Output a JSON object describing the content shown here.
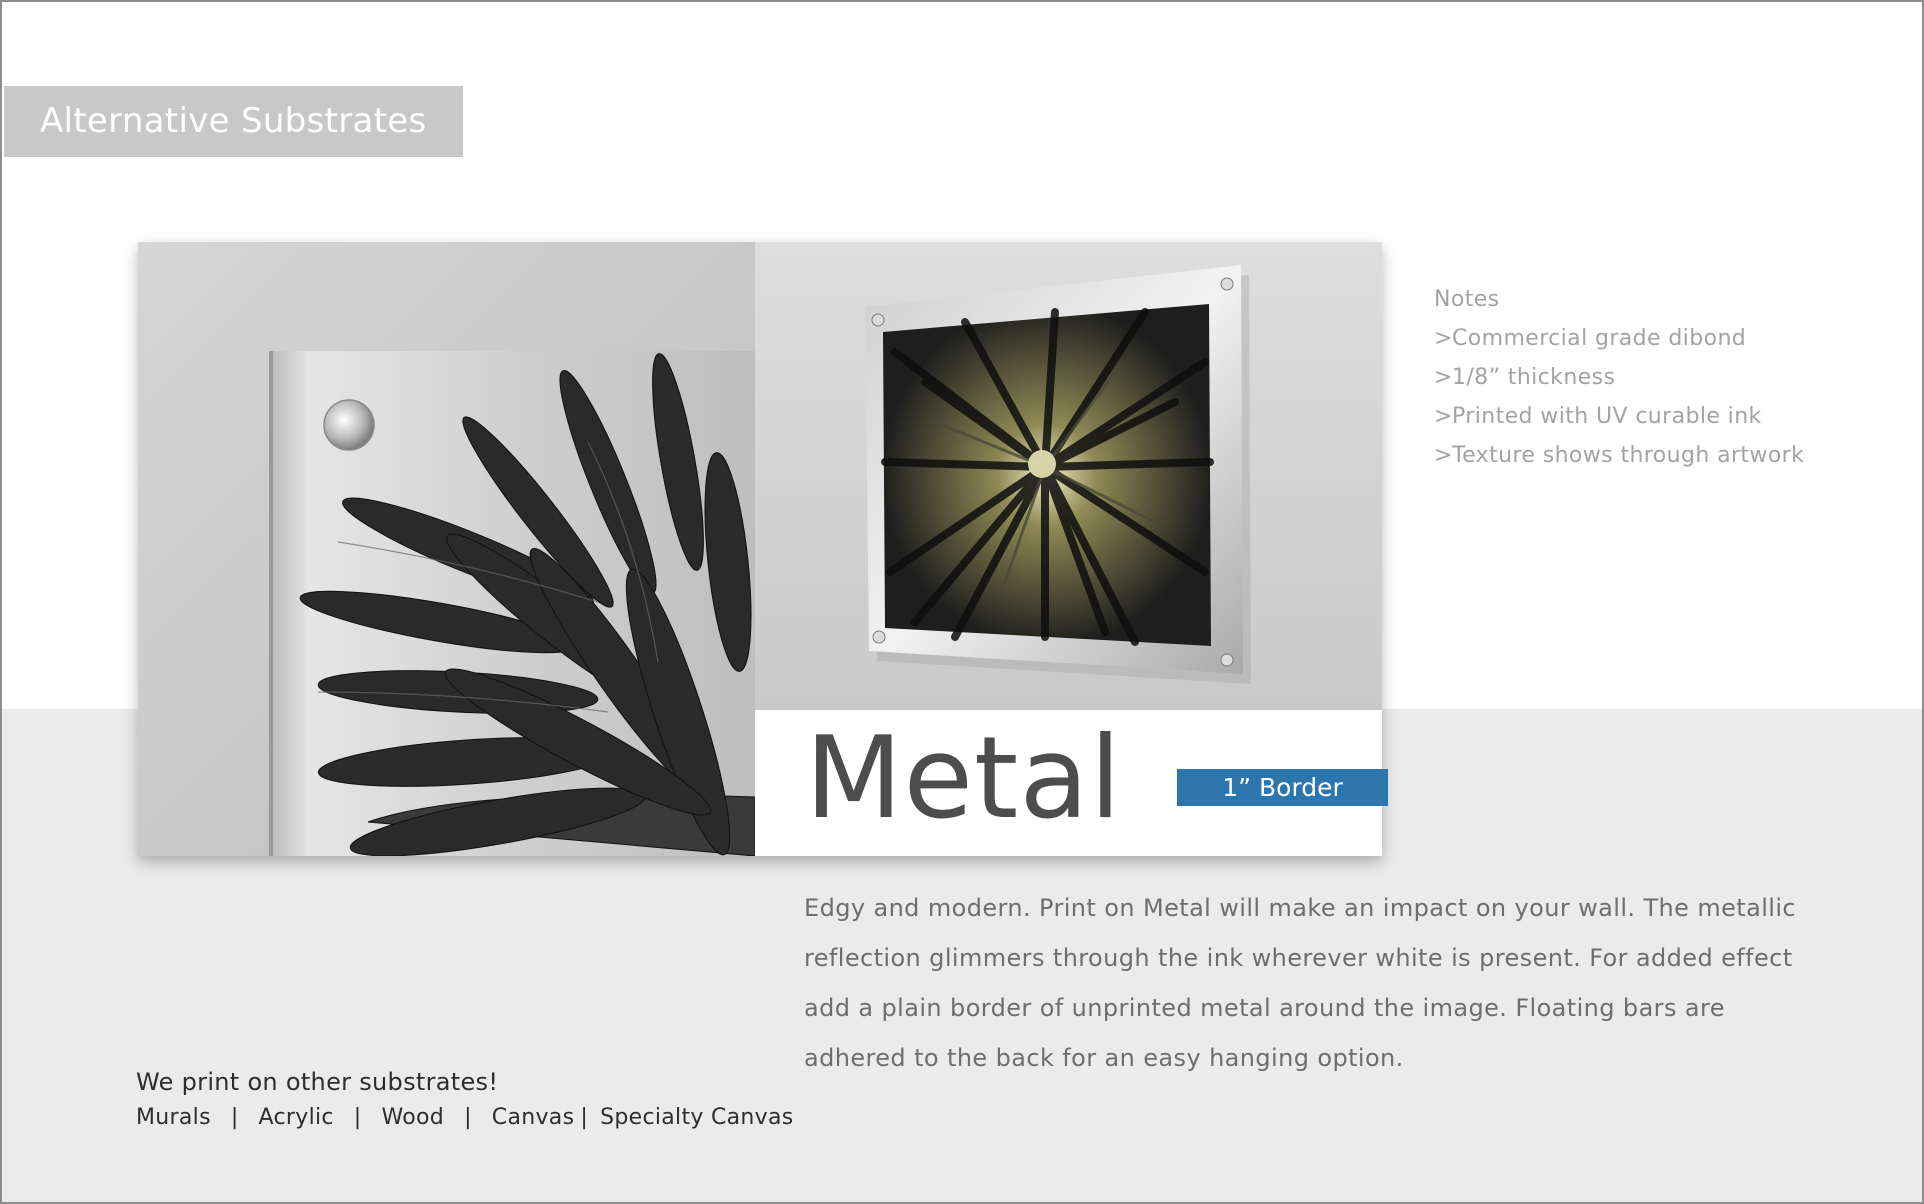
{
  "header": {
    "title": "Alternative Substrates"
  },
  "product": {
    "name": "Metal",
    "badge": "1” Border",
    "description": "Edgy and modern. Print on Metal will make an impact on your wall. The metallic reflection glimmers through the ink wherever white is present. For added effect add a plain border of unprinted metal around the image. Floating bars are adhered to the back for an easy hanging option."
  },
  "notes": {
    "title": "Notes",
    "items": [
      "Commercial grade dibond",
      "1/8” thickness",
      "Printed with UV curable ink",
      "Texture shows through artwork"
    ],
    "bullet": ">"
  },
  "other_substrates": {
    "heading": "We print on other substrates!",
    "items": [
      "Murals",
      "Acrylic",
      "Wood",
      "Canvas",
      "Specialty Canvas"
    ],
    "separator": "|"
  },
  "colors": {
    "accent": "#2d75ad",
    "title_tab": "#c8c8c8",
    "band": "#ebebeb",
    "notes_text": "#a3a3a3"
  },
  "images": {
    "closeup": "metal print close-up with standoff and dark petals",
    "wall": "metal print of dark flower mounted on wall with four standoffs"
  }
}
